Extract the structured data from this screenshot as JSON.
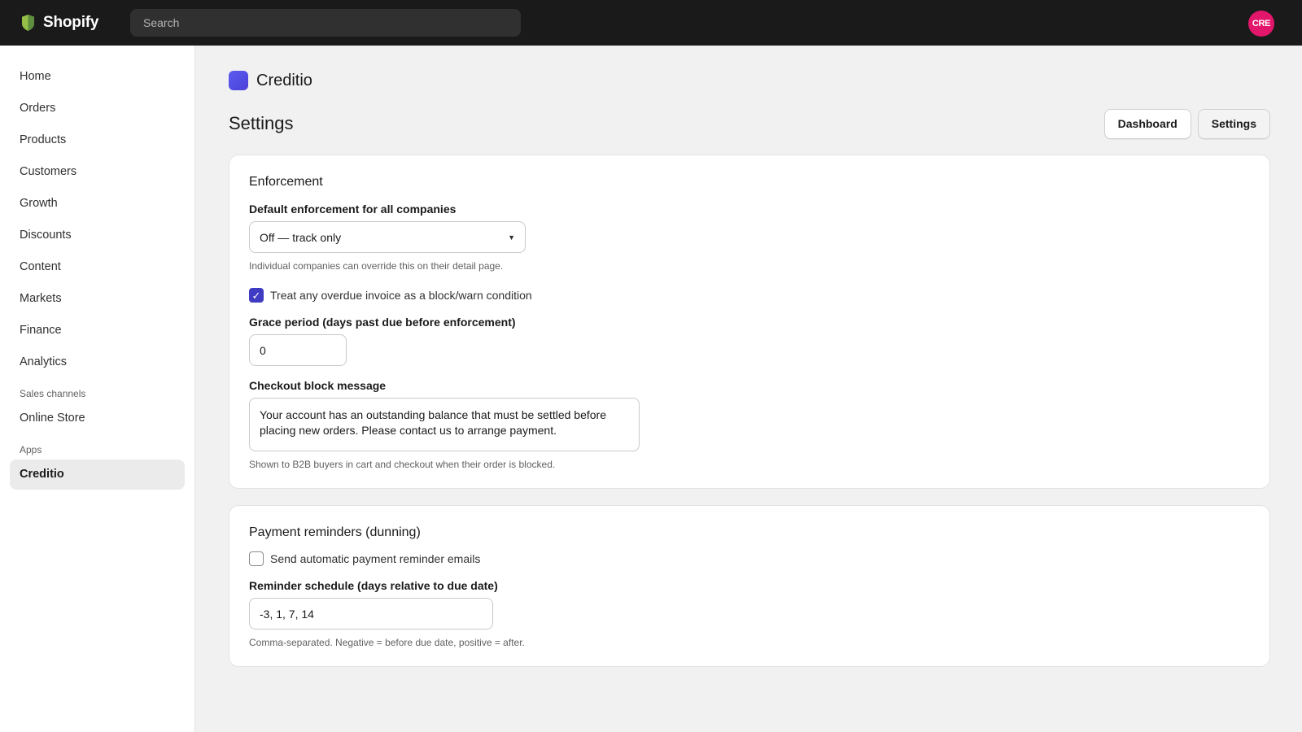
{
  "topbar": {
    "brand_name": "Shopify",
    "search_placeholder": "Search",
    "avatar_initials": "CRE",
    "avatar_color": "#e2176b"
  },
  "sidebar": {
    "items": [
      {
        "label": "Home"
      },
      {
        "label": "Orders"
      },
      {
        "label": "Products"
      },
      {
        "label": "Customers"
      },
      {
        "label": "Growth"
      },
      {
        "label": "Discounts"
      },
      {
        "label": "Content"
      },
      {
        "label": "Markets"
      },
      {
        "label": "Finance"
      },
      {
        "label": "Analytics"
      }
    ],
    "sales_channels_heading": "Sales channels",
    "sales_channels": [
      {
        "label": "Online Store"
      }
    ],
    "apps_heading": "Apps",
    "apps": [
      {
        "label": "Creditio",
        "active": true
      }
    ]
  },
  "app": {
    "name": "Creditio",
    "icon_color": "#5b5cf0"
  },
  "page": {
    "title": "Settings",
    "buttons": {
      "dashboard": "Dashboard",
      "settings": "Settings"
    }
  },
  "enforcement": {
    "title": "Enforcement",
    "default_label": "Default enforcement for all companies",
    "default_value": "Off — track only",
    "default_help": "Individual companies can override this on their detail page.",
    "overdue_checkbox_label": "Treat any overdue invoice as a block/warn condition",
    "overdue_checked": true,
    "grace_label": "Grace period (days past due before enforcement)",
    "grace_value": "0",
    "message_label": "Checkout block message",
    "message_value": "Your account has an outstanding balance that must be settled before placing new orders. Please contact us to arrange payment.",
    "message_help": "Shown to B2B buyers in cart and checkout when their order is blocked."
  },
  "dunning": {
    "title": "Payment reminders (dunning)",
    "auto_checkbox_label": "Send automatic payment reminder emails",
    "auto_checked": false,
    "schedule_label": "Reminder schedule (days relative to due date)",
    "schedule_value": "-3, 1, 7, 14",
    "schedule_help": "Comma-separated. Negative = before due date, positive = after."
  },
  "colors": {
    "topbar_bg": "#1a1a1a",
    "accent": "#3f3bc2",
    "page_bg": "#f1f1f1"
  }
}
